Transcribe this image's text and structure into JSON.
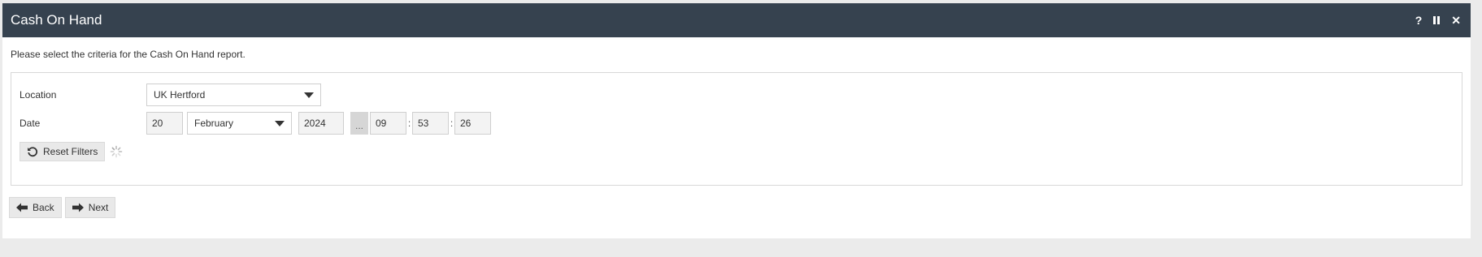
{
  "window": {
    "title": "Cash On Hand",
    "help_label": "?",
    "close_label": "✕"
  },
  "intro_text": "Please select the criteria for the Cash On Hand report.",
  "filters": {
    "location": {
      "label": "Location",
      "value": "UK Hertford"
    },
    "date": {
      "label": "Date",
      "day": "20",
      "month": "February",
      "year": "2024",
      "picker_label": "...",
      "hour": "09",
      "minute": "53",
      "second": "26",
      "separator": ":"
    },
    "reset_label": "Reset Filters"
  },
  "nav": {
    "back_label": "Back",
    "next_label": "Next"
  },
  "colors": {
    "titlebar": "#36424f",
    "background": "#ebebeb"
  },
  "icons": [
    "help-icon",
    "pause-icon",
    "close-icon",
    "chevron-down-icon",
    "reset-icon",
    "loading-spinner-icon",
    "arrow-left-icon",
    "arrow-right-icon"
  ]
}
